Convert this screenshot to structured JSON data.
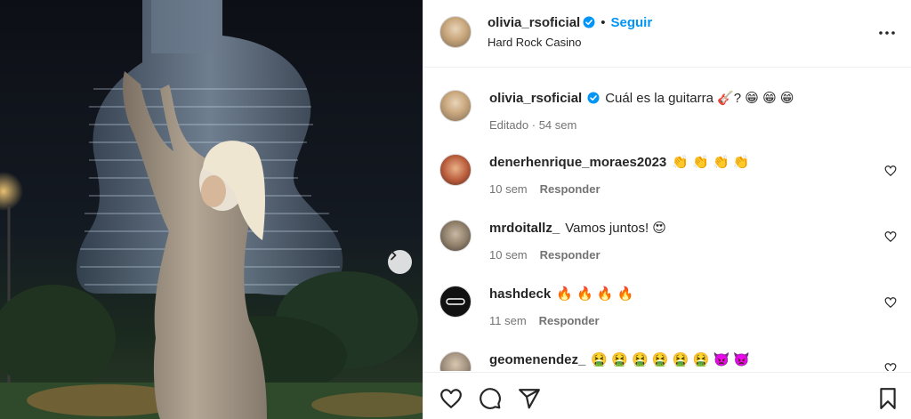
{
  "post": {
    "username": "olivia_rsoficial",
    "follow_label": "Seguir",
    "separator": "•",
    "location": "Hard Rock Casino"
  },
  "caption": {
    "username": "olivia_rsoficial",
    "text": "Cuál es la guitarra 🎸? 😁 😁 😁",
    "edited": "Editado",
    "time": "54 sem",
    "meta_separator": "·"
  },
  "comments": [
    {
      "username": "denerhenrique_moraes2023",
      "text": "👏 👏 👏 👏",
      "time": "10 sem",
      "reply_label": "Responder"
    },
    {
      "username": "mrdoitallz_",
      "text": "Vamos juntos! 😍",
      "time": "10 sem",
      "reply_label": "Responder"
    },
    {
      "username": "hashdeck",
      "text": "🔥 🔥 🔥 🔥",
      "time": "11 sem",
      "reply_label": "Responder"
    },
    {
      "username": "geomenendez_",
      "text": "🤮 🤮 🤮 🤮 🤮 🤮 👿 👿",
      "time": "",
      "reply_label": ""
    }
  ],
  "icons": {
    "verified": "verified-badge-icon",
    "more": "more-options-icon",
    "next": "chevron-right-icon",
    "like": "heart-icon",
    "comment": "comment-icon",
    "share": "paper-plane-icon",
    "save": "bookmark-icon"
  },
  "colors": {
    "accent": "#0095f6",
    "verified": "#0095f6",
    "muted": "#737373"
  }
}
